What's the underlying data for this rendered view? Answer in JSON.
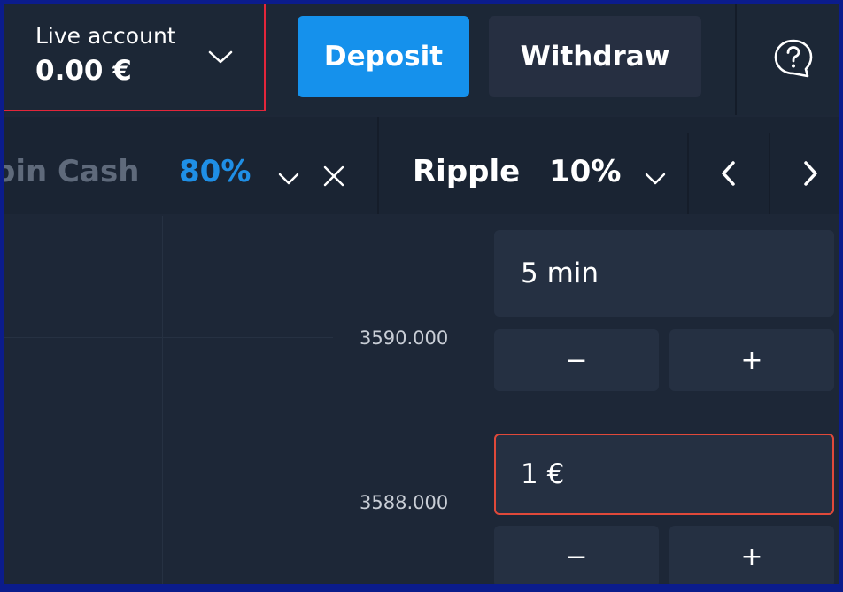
{
  "header": {
    "account_label": "Live account",
    "balance": "0.00 €",
    "deposit_label": "Deposit",
    "withdraw_label": "Withdraw"
  },
  "assets": [
    {
      "name": "oin Cash",
      "payout": "80%",
      "state": "inactive"
    },
    {
      "name": "Ripple",
      "payout": "10%",
      "state": "active"
    }
  ],
  "chart": {
    "price_labels": [
      "3590.000",
      "3588.000"
    ]
  },
  "trade": {
    "duration": "5 min",
    "amount": "1 €",
    "minus": "−",
    "plus": "+"
  },
  "colors": {
    "accent": "#1591ec",
    "highlight_border": "#e3263b",
    "amount_border": "#e0493a",
    "background": "#1d2737"
  },
  "icons": [
    "chevron-down-icon",
    "help-icon",
    "close-icon",
    "chevron-left-icon",
    "chevron-right-icon"
  ]
}
